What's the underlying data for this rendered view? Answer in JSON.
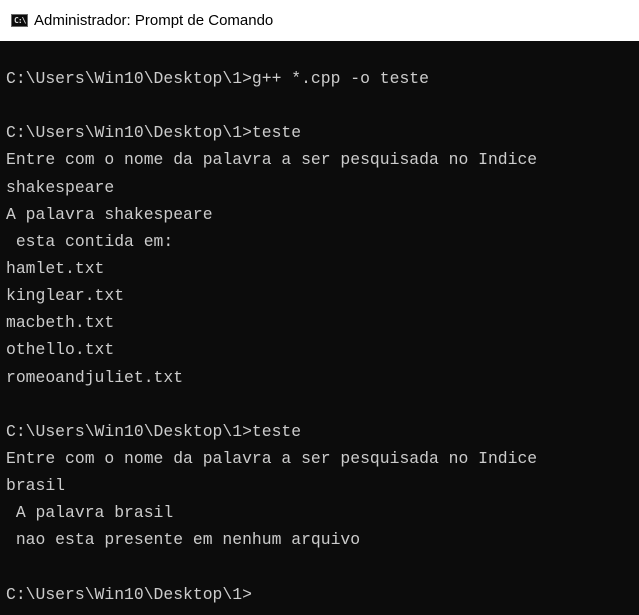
{
  "window": {
    "title": "Administrador: Prompt de Comando",
    "icon": "cmd-icon",
    "icon_label": "C:\\"
  },
  "console": {
    "lines": [
      "C:\\Users\\Win10\\Desktop\\1>g++ *.cpp -o teste",
      "",
      "C:\\Users\\Win10\\Desktop\\1>teste",
      "Entre com o nome da palavra a ser pesquisada no Indice",
      "shakespeare",
      "A palavra shakespeare",
      " esta contida em:",
      "hamlet.txt",
      "kinglear.txt",
      "macbeth.txt",
      "othello.txt",
      "romeoandjuliet.txt",
      "",
      "C:\\Users\\Win10\\Desktop\\1>teste",
      "Entre com o nome da palavra a ser pesquisada no Indice",
      "brasil",
      " A palavra brasil",
      " nao esta presente em nenhum arquivo",
      "",
      "C:\\Users\\Win10\\Desktop\\1>"
    ]
  }
}
